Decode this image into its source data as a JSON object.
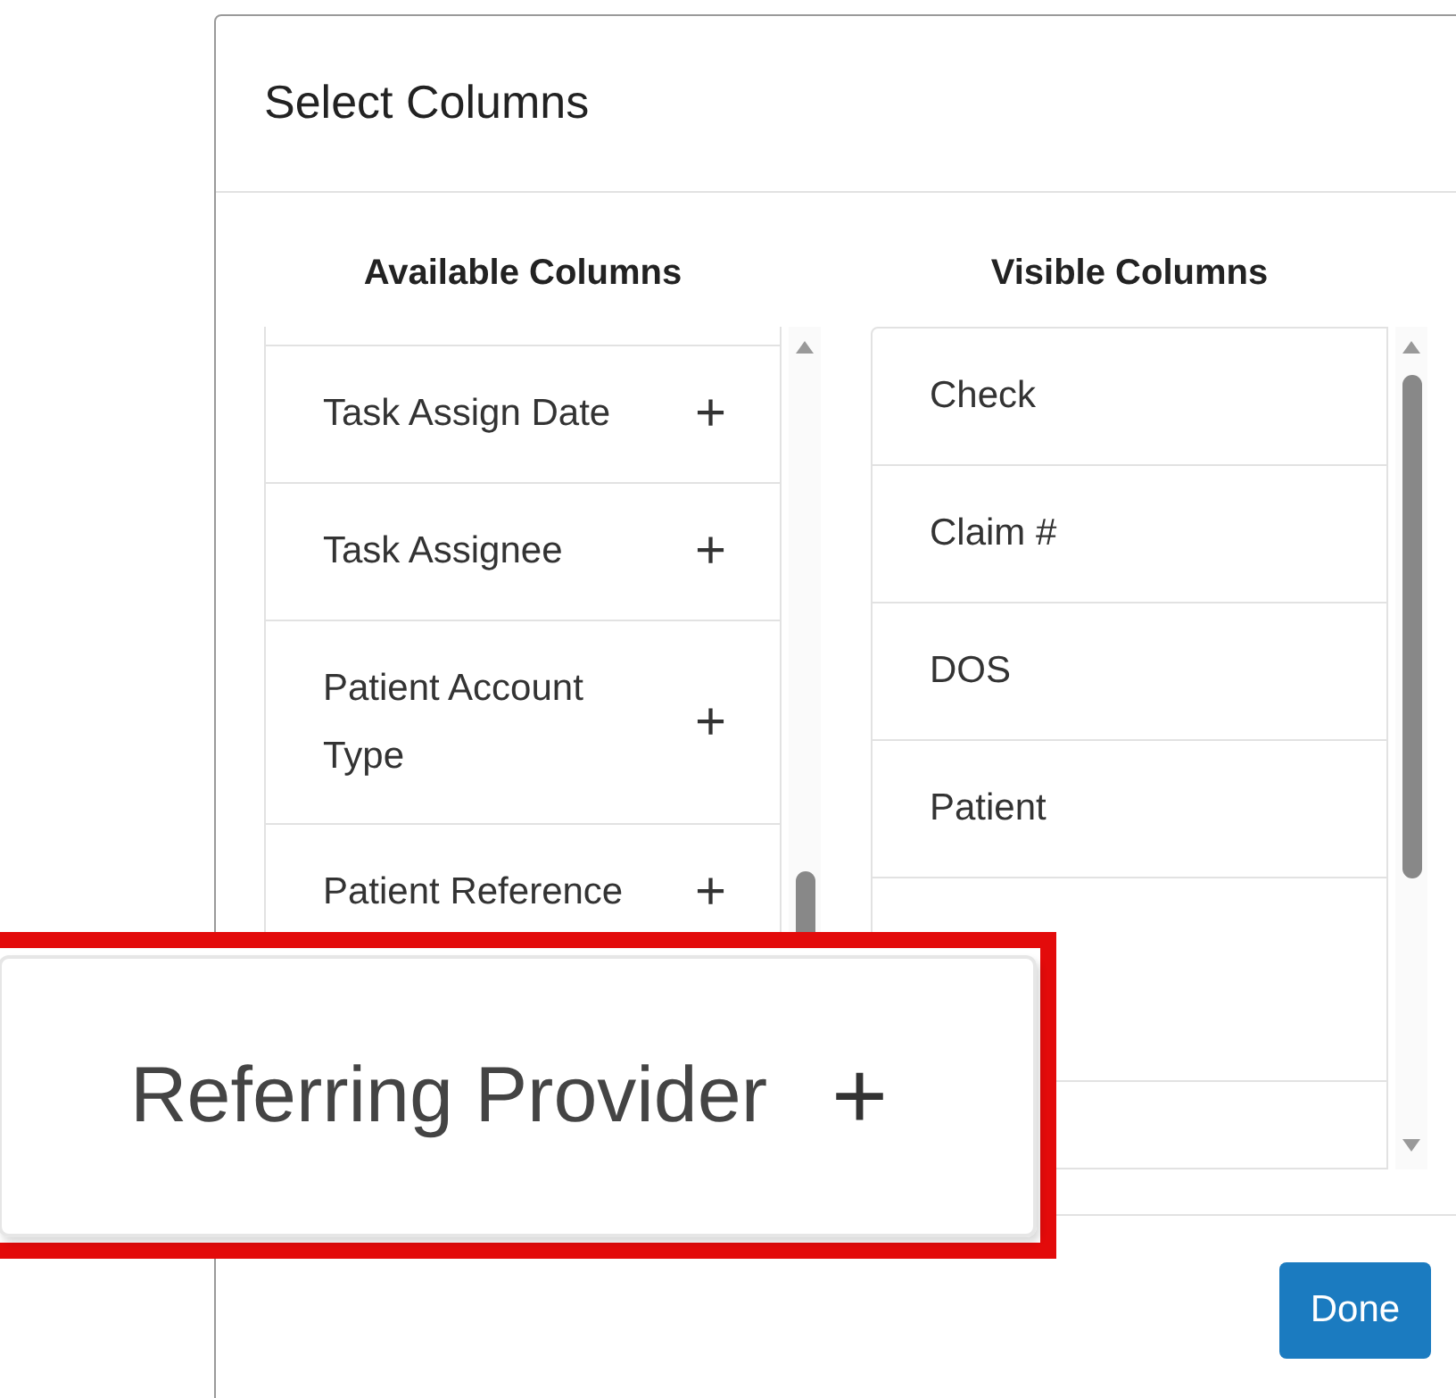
{
  "dialog": {
    "title": "Select Columns",
    "available": {
      "heading": "Available Columns",
      "items": [
        {
          "label": "Task Assign Date",
          "add": "+"
        },
        {
          "label": "Task Assignee",
          "add": "+"
        },
        {
          "label": "Patient Account Type",
          "add": "+"
        },
        {
          "label": "Patient Reference",
          "add": "+"
        }
      ]
    },
    "visible": {
      "heading": "Visible Columns",
      "items": [
        {
          "label": "Check"
        },
        {
          "label": "Claim #"
        },
        {
          "label": "DOS"
        },
        {
          "label": "Patient"
        }
      ]
    },
    "done_button": "Done"
  },
  "callout": {
    "label": "Referring Provider",
    "add": "+"
  }
}
